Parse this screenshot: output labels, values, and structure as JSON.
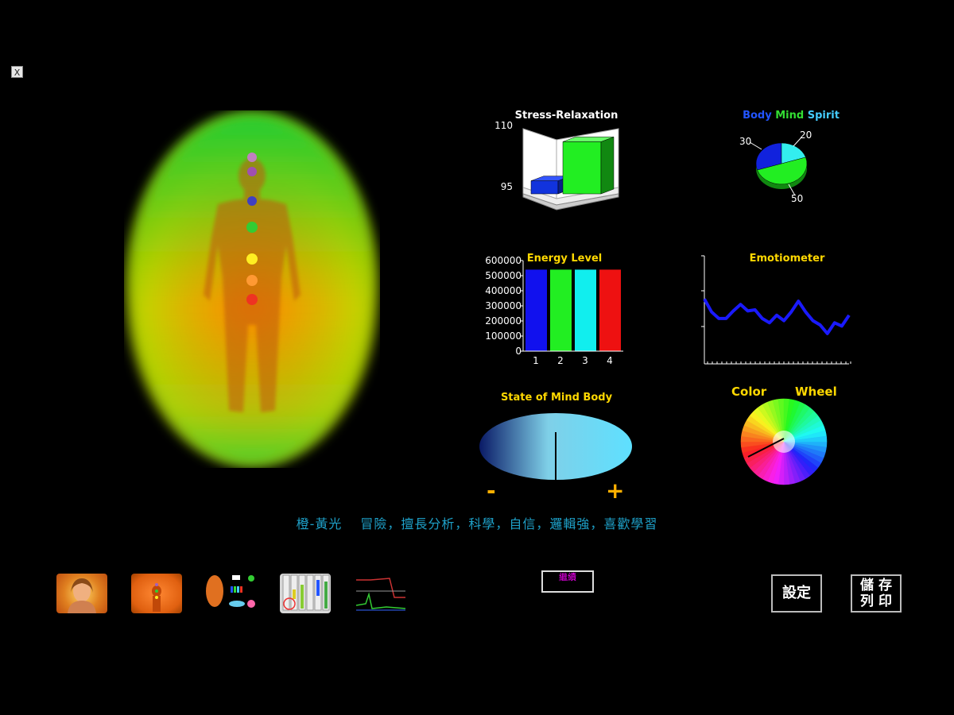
{
  "window": {
    "close_label": "X"
  },
  "stress_relaxation": {
    "title": "Stress-Relaxation",
    "y_max_label": "110",
    "y_min_label": "95"
  },
  "body_mind_spirit": {
    "title_body": "Body",
    "title_mind": "Mind",
    "title_spirit": "Spirit",
    "labels": [
      "30",
      "20",
      "50"
    ]
  },
  "energy_level": {
    "title": "Energy Level",
    "y_ticks": [
      "600000",
      "500000",
      "400000",
      "300000",
      "200000",
      "100000",
      "0"
    ],
    "x_ticks": [
      "1",
      "2",
      "3",
      "4"
    ]
  },
  "emotiometer": {
    "title": "Emotiometer"
  },
  "state_of_mind": {
    "title": "State of Mind Body",
    "minus": "-",
    "plus": "+"
  },
  "color_wheel": {
    "title_left": "Color",
    "title_right": "Wheel"
  },
  "caption": {
    "text": "橙-黃光　 冒險，擅長分析，科學，自信，邏輯強，喜歡學習"
  },
  "center_button": {
    "label": "繼續"
  },
  "settings_button": {
    "label": "設定"
  },
  "save_print_button": {
    "line1": "儲 存",
    "line2": "列 印"
  },
  "colors": {
    "title_yellow": "#ffd800",
    "caption": "#1ea0c8",
    "body": "#2255ff",
    "mind": "#33dd33",
    "spirit": "#44ccff"
  },
  "chart_data": [
    {
      "type": "bar",
      "title": "Stress-Relaxation",
      "categories": [
        "",
        ""
      ],
      "values": [
        98,
        107
      ],
      "ylim": [
        95,
        110
      ]
    },
    {
      "type": "pie",
      "title": "Body Mind Spirit",
      "series": [
        {
          "name": "Body",
          "value": 30
        },
        {
          "name": "Spirit",
          "value": 20
        },
        {
          "name": "Mind",
          "value": 50
        }
      ]
    },
    {
      "type": "bar",
      "title": "Energy Level",
      "categories": [
        "1",
        "2",
        "3",
        "4"
      ],
      "values": [
        540000,
        540000,
        540000,
        540000
      ],
      "ylim": [
        0,
        600000
      ]
    },
    {
      "type": "line",
      "title": "Emotiometer",
      "values": [
        60,
        48,
        42,
        42,
        49,
        55,
        49,
        50,
        42,
        38,
        45,
        40,
        48,
        58,
        48,
        40,
        36,
        28,
        38,
        35,
        45
      ],
      "ylim": [
        0,
        100
      ]
    },
    {
      "type": "gauge",
      "title": "State of Mind Body",
      "value": 0.5
    }
  ]
}
